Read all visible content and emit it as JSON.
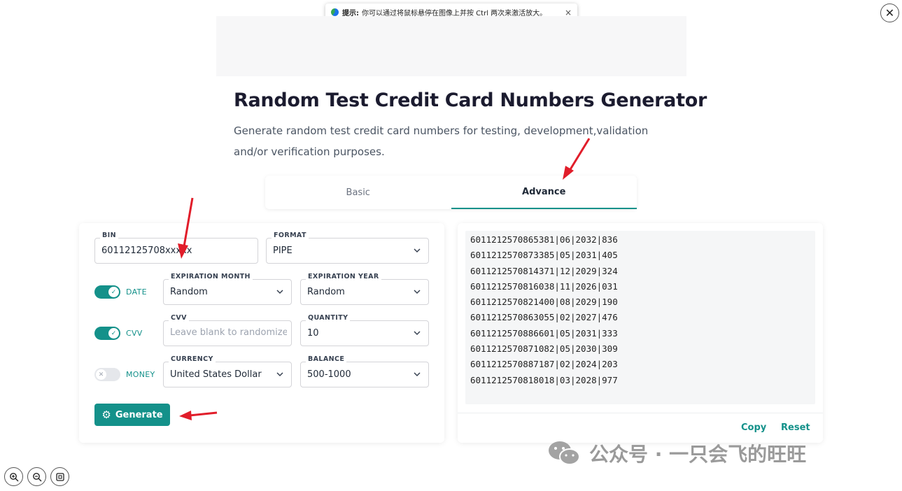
{
  "viewer": {
    "tip_label": "提示:",
    "tip_text": "你可以通过将鼠标悬停在图像上并按 Ctrl 两次来激活放大。",
    "tip_close": "×",
    "close_glyph": "✕"
  },
  "header": {
    "title": "Random Test Credit Card Numbers Generator",
    "description": "Generate random test credit card numbers for testing, development,validation and/or verification purposes."
  },
  "tabs": [
    {
      "label": "Basic",
      "active": false
    },
    {
      "label": "Advance",
      "active": true
    }
  ],
  "form": {
    "bin": {
      "label": "BIN",
      "value": "60112125708xxxxx"
    },
    "format": {
      "label": "FORMAT",
      "value": "PIPE"
    },
    "date_toggle": {
      "label": "DATE",
      "on": true
    },
    "expiration_month": {
      "label": "EXPIRATION MONTH",
      "value": "Random"
    },
    "expiration_year": {
      "label": "EXPIRATION YEAR",
      "value": "Random"
    },
    "cvv_toggle": {
      "label": "CVV",
      "on": true
    },
    "cvv": {
      "label": "CVV",
      "placeholder": "Leave blank to randomize"
    },
    "quantity": {
      "label": "QUANTITY",
      "value": "10"
    },
    "money_toggle": {
      "label": "MONEY",
      "on": false
    },
    "currency": {
      "label": "CURRENCY",
      "value": "United States Dollar"
    },
    "balance": {
      "label": "BALANCE",
      "value": "500-1000"
    },
    "generate_label": "Generate"
  },
  "output": {
    "lines": [
      "6011212570865381|06|2032|836",
      "6011212570873385|05|2031|405",
      "6011212570814371|12|2029|324",
      "6011212570816038|11|2026|031",
      "6011212570821400|08|2029|190",
      "6011212570863055|02|2027|476",
      "6011212570886601|05|2031|333",
      "6011212570871082|05|2030|309",
      "6011212570887187|02|2024|203",
      "6011212570818018|03|2028|977"
    ],
    "copy_label": "Copy",
    "reset_label": "Reset"
  },
  "watermark": {
    "text": "公众号 · 一只会飞的旺旺"
  },
  "colors": {
    "accent": "#14918a",
    "arrow": "#e11d2a"
  }
}
